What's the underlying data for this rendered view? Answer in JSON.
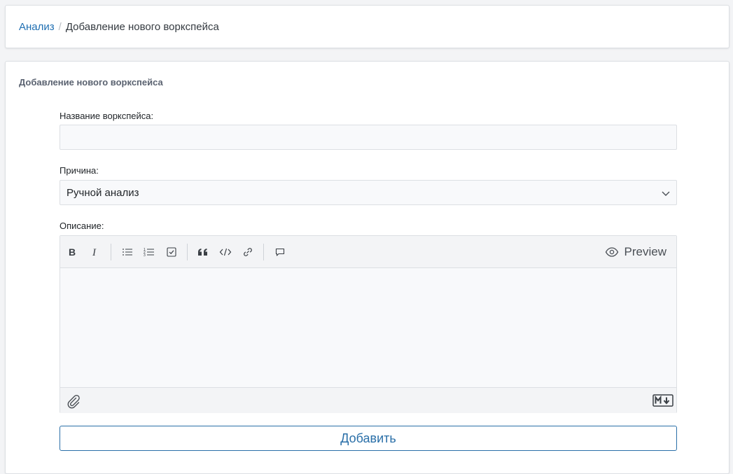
{
  "breadcrumb": {
    "parent": "Анализ",
    "separator": "/",
    "current": "Добавление нового воркспейса"
  },
  "form": {
    "section_title": "Добавление нового воркспейса",
    "name_label": "Название воркспейса:",
    "name_value": "",
    "reason_label": "Причина:",
    "reason_selected": "Ручной анализ",
    "description_label": "Описание:",
    "description_value": "",
    "submit_label": "Добавить"
  },
  "editor": {
    "toolbar": {
      "bold_icon": "bold-icon",
      "italic_icon": "italic-icon",
      "bullet_list_icon": "bullet-list-icon",
      "ordered_list_icon": "ordered-list-icon",
      "checklist_icon": "checklist-icon",
      "quote_icon": "quote-icon",
      "code_icon": "code-icon",
      "link_icon": "link-icon",
      "comment_icon": "comment-icon",
      "preview_label": "Preview"
    },
    "footer": {
      "attach_icon": "paperclip-icon",
      "markdown_badge": "markdown-icon"
    }
  },
  "colors": {
    "link": "#1f6fb2",
    "primary_outline": "#2a6fa8",
    "border": "#dcdfe3",
    "input_bg": "#f8f9fb"
  }
}
